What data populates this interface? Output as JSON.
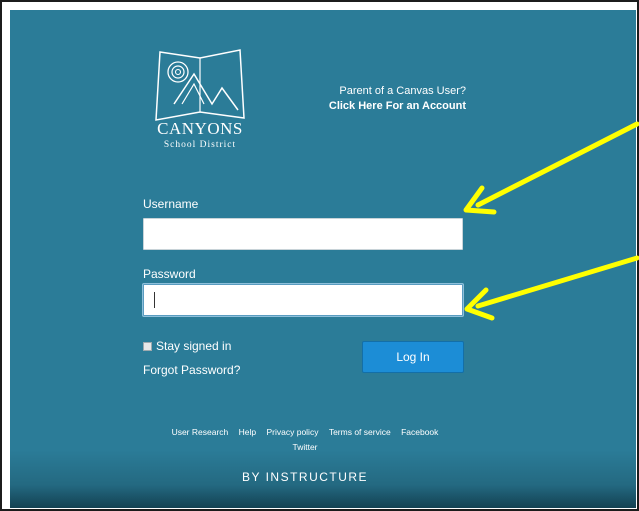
{
  "logo": {
    "name": "CANYONS",
    "subtitle": "School District"
  },
  "parent_link": {
    "line1": "Parent of a Canvas User?",
    "line2": "Click Here For an Account"
  },
  "login_form": {
    "username_label": "Username",
    "username_value": "",
    "password_label": "Password",
    "password_value": "",
    "stay_signed_in_label": "Stay signed in",
    "stay_signed_in_checked": false,
    "forgot_password_label": "Forgot Password?",
    "login_button_label": "Log In"
  },
  "footer": {
    "links": [
      "User Research",
      "Help",
      "Privacy policy",
      "Terms of service",
      "Facebook",
      "Twitter"
    ],
    "brand": "BY INSTRUCTURE"
  },
  "colors": {
    "panel_background": "#2b7c98",
    "login_button": "#1c8dd6",
    "annotation_arrow": "#ffff00"
  }
}
